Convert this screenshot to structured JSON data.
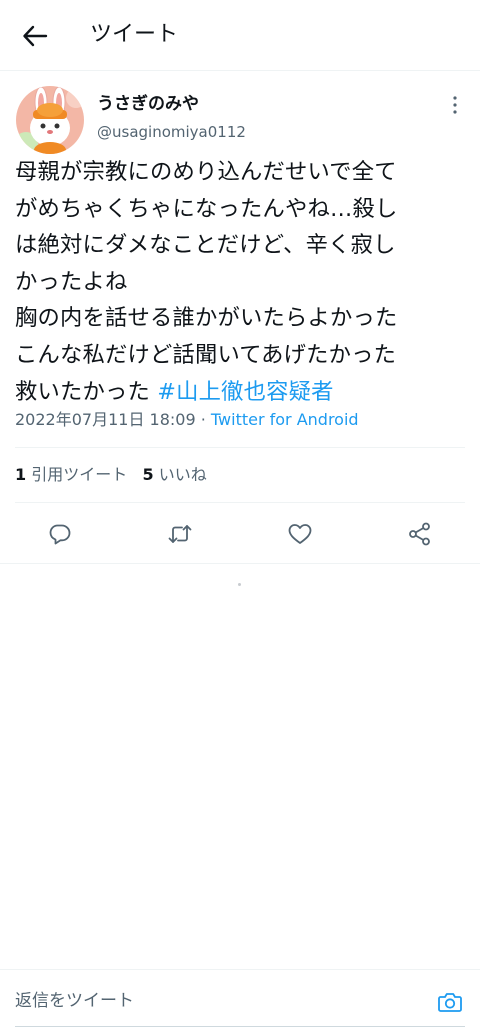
{
  "header": {
    "title": "ツイート"
  },
  "tweet": {
    "display_name": "うさぎのみや",
    "handle": "@usaginomiya0112",
    "text_lines": [
      "母親が宗教にのめり込んだせいで全て",
      "がめちゃくちゃになったんやね…殺し",
      "は絶対にダメなことだけど、辛く寂し",
      "かったよね",
      "胸の内を話せる誰かがいたらよかった",
      "こんな私だけど話聞いてあげたかった",
      "救いたかった "
    ],
    "hashtag": "#山上徹也容疑者",
    "timestamp": "2022年07月11日 18:09",
    "meta_separator": " · ",
    "source": "Twitter for Android"
  },
  "stats": {
    "quotes_count": "1",
    "quotes_label": "引用ツイート",
    "likes_count": "5",
    "likes_label": "いいね"
  },
  "reply": {
    "placeholder": "返信をツイート"
  },
  "icons": {
    "back": "arrow-left-icon",
    "more": "more-vertical-icon",
    "reply": "comment-icon",
    "retweet": "retweet-icon",
    "like": "heart-icon",
    "share": "share-icon",
    "camera": "camera-icon"
  },
  "colors": {
    "accent": "#1d9bf0",
    "secondary_text": "#536471",
    "text": "#0f1419"
  }
}
